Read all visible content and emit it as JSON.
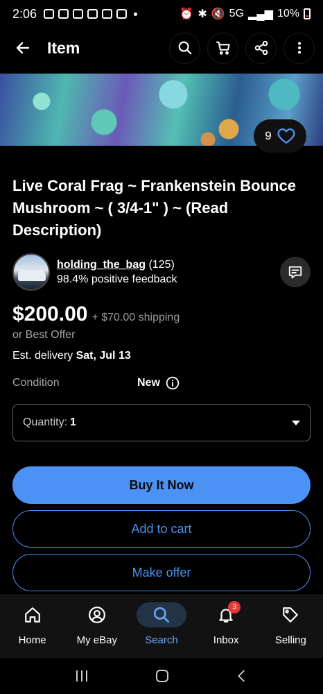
{
  "status_bar": {
    "time": "2:06",
    "network": "5G",
    "battery": "10%"
  },
  "app_bar": {
    "title": "Item"
  },
  "hero": {
    "favorite_count": "9"
  },
  "item": {
    "title": "Live Coral Frag ~ Frankenstein Bounce Mushroom ~ ( 3/4-1\" ) ~ (Read Description)",
    "seller": {
      "name": "holding_the_bag",
      "feedback_count": "(125)",
      "positive_feedback": "98.4% positive feedback"
    },
    "price": "$200.00",
    "shipping": "+ $70.00 shipping",
    "best_offer": "or Best Offer",
    "delivery_label": "Est. delivery",
    "delivery_date": "Sat, Jul 13",
    "condition_label": "Condition",
    "condition_value": "New",
    "quantity_label": "Quantity:",
    "quantity_value": "1"
  },
  "buttons": {
    "buy_now": "Buy It Now",
    "add_to_cart": "Add to cart",
    "make_offer": "Make offer"
  },
  "bottom_nav": [
    {
      "label": "Home",
      "icon": "home-icon"
    },
    {
      "label": "My eBay",
      "icon": "user-icon"
    },
    {
      "label": "Search",
      "icon": "search-icon"
    },
    {
      "label": "Inbox",
      "icon": "bell-icon",
      "badge": "3"
    },
    {
      "label": "Selling",
      "icon": "tag-icon"
    }
  ],
  "colors": {
    "accent": "#4c92f5",
    "background": "#000000",
    "badge": "#e53935"
  }
}
